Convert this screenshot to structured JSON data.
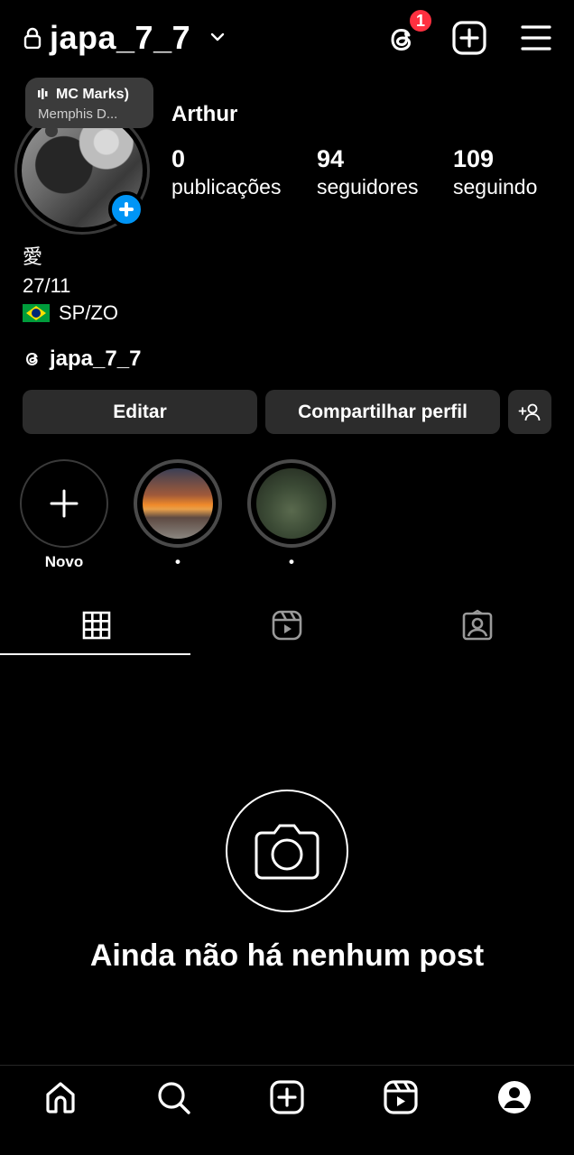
{
  "header": {
    "username": "japa_7_7",
    "notification_count": "1"
  },
  "music_note": {
    "title": "MC Marks)",
    "artist": "Memphis D..."
  },
  "profile": {
    "display_name": "Arthur",
    "stats": [
      {
        "value": "0",
        "label": "publicações"
      },
      {
        "value": "94",
        "label": "seguidores"
      },
      {
        "value": "109",
        "label": "seguindo"
      }
    ],
    "bio_lines": [
      "愛",
      "27/11",
      "SP/ZO"
    ],
    "threads_handle": "japa_7_7"
  },
  "actions": {
    "edit_label": "Editar",
    "share_label": "Compartilhar perfil"
  },
  "highlights": [
    {
      "label": "Novo"
    },
    {
      "label": "•"
    },
    {
      "label": "•"
    }
  ],
  "empty_state": {
    "text": "Ainda não há nenhum post"
  },
  "colors": {
    "accent_blue": "#0095f6",
    "badge_red": "#ff3040",
    "button_bg": "#2c2c2c"
  }
}
